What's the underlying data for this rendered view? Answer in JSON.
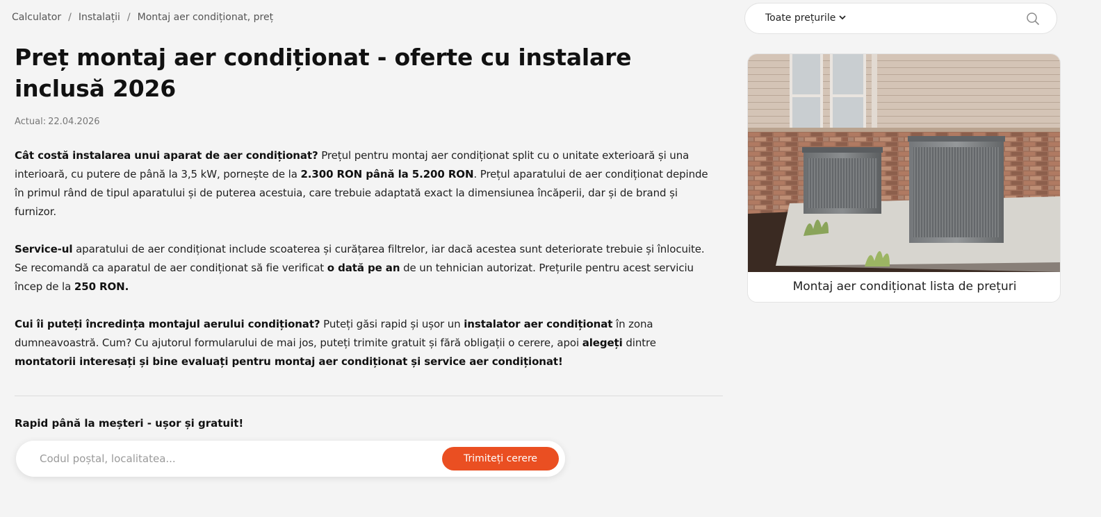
{
  "breadcrumb": {
    "items": [
      "Calculator",
      "Instalații",
      "Montaj aer condiționat, preț"
    ],
    "separator": "/"
  },
  "page": {
    "title": "Preț montaj aer condiționat - oferte cu instalare inclusă 2026",
    "updated_label": "Actual:",
    "updated_date": "22.04.2026"
  },
  "content": {
    "p1": {
      "b1": "Cât costă instalarea unui aparat de aer condiționat?",
      "t1": " Prețul pentru montaj aer condiționat split cu o unitate exterioară și una interioară, cu putere de până la 3,5 kW, pornește de la ",
      "b2": "2.300 RON până la 5.200 RON",
      "t2": ". Prețul aparatului de aer condiționat depinde în primul rând de tipul aparatului și de puterea acestuia, care trebuie adaptată exact la dimensiunea încăperii, dar și de brand și furnizor."
    },
    "p2": {
      "b1": "Service-ul",
      "t1": " aparatului de aer condiționat include scoaterea și curățarea filtrelor, iar dacă acestea sunt deteriorate trebuie și înlocuite. Se recomandă ca aparatul de aer condiționat să fie verificat ",
      "b2": "o dată pe an",
      "t2": " de un tehnician autorizat. Prețurile pentru acest serviciu încep de la ",
      "b3": "250 RON."
    },
    "p3": {
      "b1": "Cui îi puteți încredința montajul aerului condiționat?",
      "t1": " Puteți găsi rapid și ușor un ",
      "b2": "instalator aer condiționat",
      "t2": " în zona dumneavoastră. Cum? Cu ajutorul formularului de mai jos, puteți trimite gratuit și fără obligații o cerere, apoi ",
      "b3": "alegeți",
      "t3": " dintre ",
      "b4": "montatorii interesați și bine evaluați pentru montaj aer condiționat și service aer condiționat!"
    }
  },
  "form": {
    "title": "Rapid până la meșteri - ușor și gratuit!",
    "placeholder": "Codul poștal, localitatea...",
    "submit_label": "Trimiteți cerere"
  },
  "top_search": {
    "dropdown_label": "Toate prețurile",
    "chevron_icon": "chevron-down-icon",
    "search_icon": "search-icon"
  },
  "card": {
    "caption": "Montaj aer condiționat lista de prețuri"
  },
  "colors": {
    "accent": "#ea4f22",
    "background": "#f4f4f4",
    "text": "#1a1a1a"
  }
}
